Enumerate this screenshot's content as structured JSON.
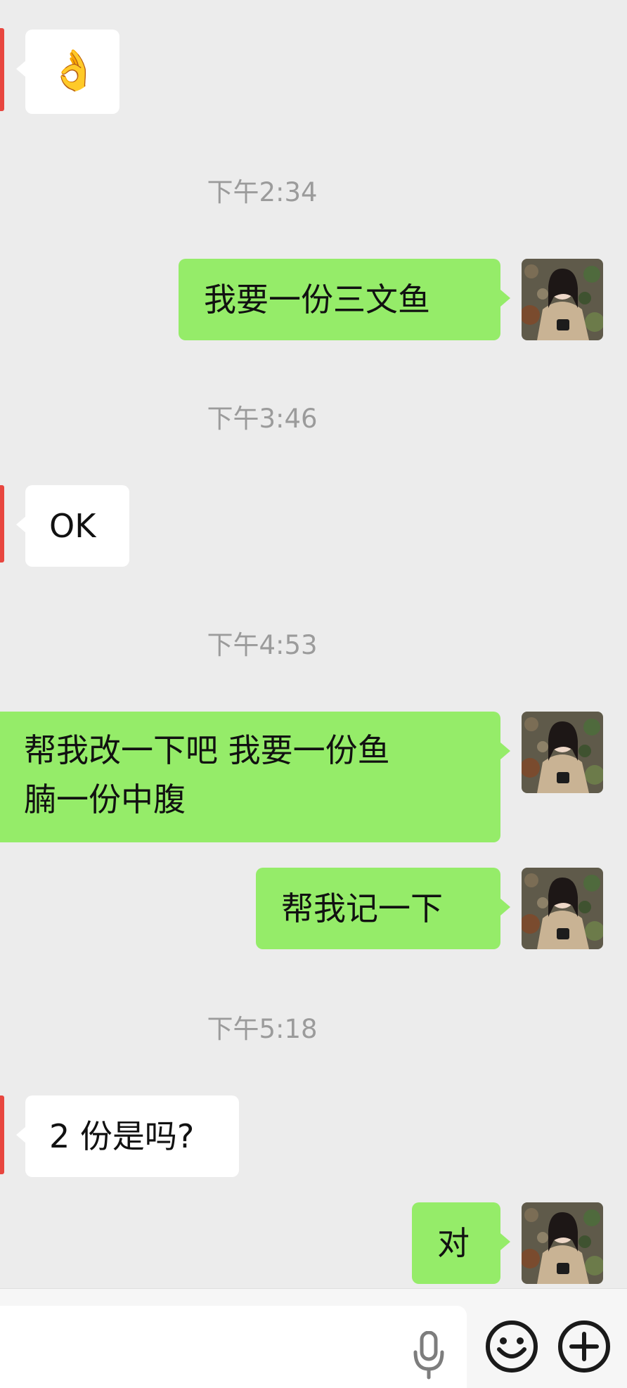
{
  "messages": [
    {
      "side": "in",
      "type": "emoji",
      "text": "👌"
    },
    {
      "type": "time",
      "text": "下午2:34"
    },
    {
      "side": "out",
      "text": "我要一份三文鱼"
    },
    {
      "type": "time",
      "text": "下午3:46"
    },
    {
      "side": "in",
      "text": "OK"
    },
    {
      "type": "time",
      "text": "下午4:53"
    },
    {
      "side": "out",
      "text": "帮我改一下吧 我要一份鱼\n腩一份中腹"
    },
    {
      "side": "out",
      "text": "帮我记一下"
    },
    {
      "type": "time",
      "text": "下午5:18"
    },
    {
      "side": "in",
      "text": "2 份是吗?"
    },
    {
      "side": "out",
      "text": "对"
    }
  ],
  "colors": {
    "background": "#ececec",
    "outgoing_bubble": "#95ec69",
    "incoming_bubble": "#ffffff",
    "avatar_accent": "#e8463f",
    "timestamp": "#9b9b9b"
  },
  "bottom_bar": {
    "icons": [
      "mic-icon",
      "emoji-icon",
      "plus-icon"
    ]
  }
}
